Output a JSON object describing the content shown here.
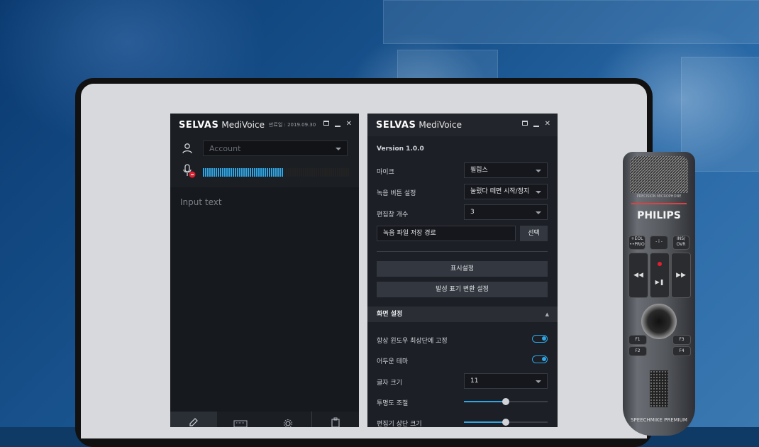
{
  "left_window": {
    "brand": "SELVAS",
    "product": "MediVoice",
    "expiry": "만료일 : 2019.09.30",
    "account_placeholder": "Account",
    "meter_level": 0.55,
    "input_placeholder": "Input text"
  },
  "right_window": {
    "brand": "SELVAS",
    "product": "MediVoice",
    "version": "Version 1.0.0",
    "settings": {
      "mic_label": "마이크",
      "mic_value": "필립스",
      "record_btn_label": "녹음 버튼 설정",
      "record_btn_value": "눌렀다 떼면 시작/정지",
      "edit_count_label": "편집창 개수",
      "edit_count_value": "3",
      "save_path_value": "녹음 파일 저장 경로",
      "select_button": "선택",
      "display_button": "표시설정",
      "pronunciation_button": "발성 표기 변환 설정",
      "section_title": "화면 설정",
      "always_on_top_label": "항상 윈도우 최상단에 고정",
      "always_on_top": true,
      "dark_theme_label": "어두운 테마",
      "dark_theme": true,
      "font_size_label": "글자 크기",
      "font_size_value": "11",
      "opacity_label": "투명도 조절",
      "opacity_level": 0.5,
      "editor_top_label": "편집기 상단 크기",
      "editor_top_level": 0.5
    }
  },
  "device": {
    "brand": "PHILIPS",
    "top_label": "PRECISION MICROPHONE",
    "buttons": [
      "+EOL ••PRIO",
      "- i -",
      "INS/ OVR",
      "F1",
      "F2",
      "F3",
      "F4"
    ],
    "bottom_label": "SPEECHMIKE PREMIUM"
  },
  "colors": {
    "accent": "#2ea6e6",
    "window_bg": "#16191e",
    "record_red": "#e02030"
  }
}
